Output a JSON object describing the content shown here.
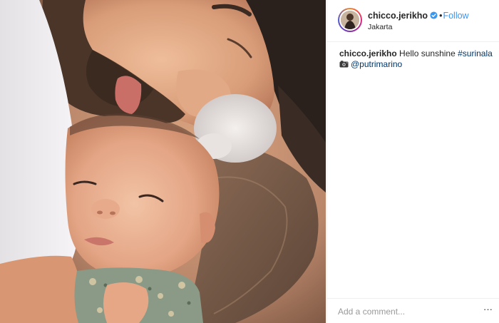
{
  "post": {
    "username": "chicco.jerikho",
    "follow_label": "Follow",
    "separator": "•",
    "location": "Jakarta",
    "icons": {
      "verified": "verified-badge-icon",
      "camera": "camera-icon",
      "more": "more-options-icon"
    }
  },
  "caption": {
    "username": "chicco.jerikho",
    "text": "Hello sunshine",
    "hashtag": "#surinala",
    "mention": "@putrimarino"
  },
  "comment": {
    "placeholder": "Add a comment...",
    "more_label": "···"
  },
  "colors": {
    "link_blue": "#3897f0",
    "hashtag": "#003569",
    "text": "#262626",
    "placeholder": "#999999",
    "border": "#efefef"
  }
}
